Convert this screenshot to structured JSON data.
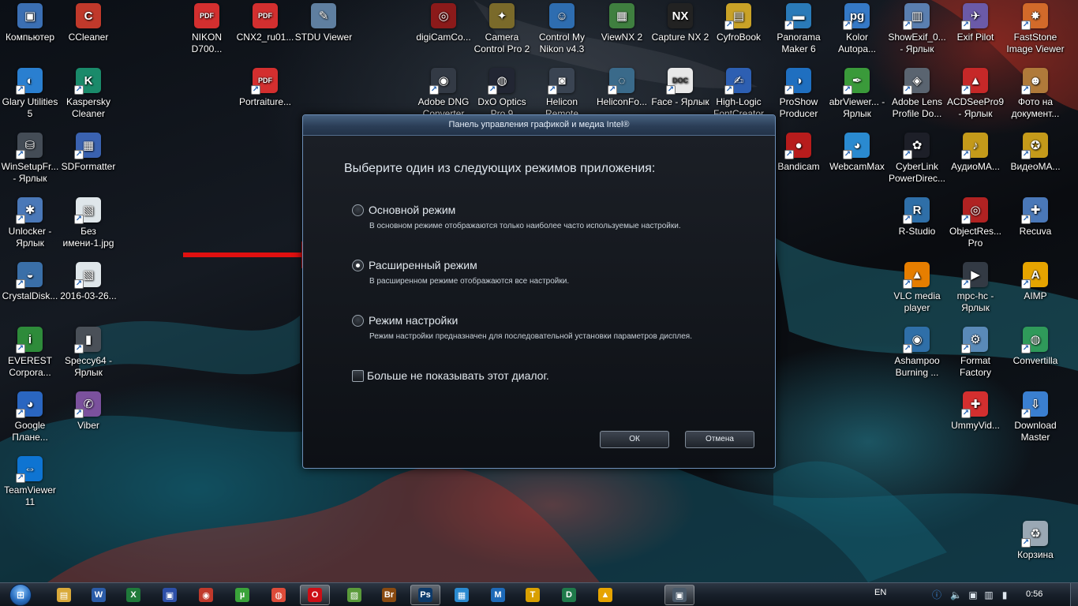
{
  "desktop": {
    "icons": [
      {
        "label": "Компьютер",
        "icon": "computer-icon",
        "color": "#3b6fb3",
        "glyph": "▣"
      },
      {
        "label": "CCleaner",
        "icon": "ccleaner-icon",
        "color": "#c0392b",
        "glyph": "C"
      },
      {
        "label": "NIKON D700...",
        "icon": "pdf-icon",
        "color": "#d32f2f",
        "glyph": "PDF"
      },
      {
        "label": "CNX2_ru01...",
        "icon": "pdf-icon",
        "color": "#d32f2f",
        "glyph": "PDF"
      },
      {
        "label": "STDU Viewer",
        "icon": "stdu-viewer-icon",
        "color": "#5f7fa0",
        "glyph": "✎"
      },
      {
        "label": "digiCamCo...",
        "icon": "digicam-icon",
        "color": "#8b1a1a",
        "glyph": "◎"
      },
      {
        "label": "Camera Control Pro 2",
        "icon": "camera-control-icon",
        "color": "#7a6a2a",
        "glyph": "✦"
      },
      {
        "label": "Control My Nikon v4.3",
        "icon": "control-nikon-icon",
        "color": "#2e6db0",
        "glyph": "☺"
      },
      {
        "label": "ViewNX 2",
        "icon": "viewnx-icon",
        "color": "#3f7f3f",
        "glyph": "▦"
      },
      {
        "label": "Capture NX 2",
        "icon": "capture-nx-icon",
        "color": "#222222",
        "glyph": "NX"
      },
      {
        "label": "CyfroBook",
        "icon": "cyfrobook-icon",
        "color": "#c9a227",
        "glyph": "▤"
      },
      {
        "label": "Panorama Maker 6",
        "icon": "panorama-icon",
        "color": "#2a7ab8",
        "glyph": "▬"
      },
      {
        "label": "Kolor Autopa...",
        "icon": "kolor-icon",
        "color": "#3579c6",
        "glyph": "pg"
      },
      {
        "label": "ShowExif_0... - Ярлык",
        "icon": "showexif-icon",
        "color": "#5a7fb0",
        "glyph": "▥"
      },
      {
        "label": "Exif Pilot",
        "icon": "exif-pilot-icon",
        "color": "#6b5aa8",
        "glyph": "✈"
      },
      {
        "label": "FastStone Image Viewer",
        "icon": "faststone-icon",
        "color": "#d26a2a",
        "glyph": "✸"
      },
      {
        "label": "Glary Utilities 5",
        "icon": "glary-icon",
        "color": "#2a7fd0",
        "glyph": "◐"
      },
      {
        "label": "Kaspersky Cleaner",
        "icon": "kaspersky-icon",
        "color": "#1a8a6a",
        "glyph": "K"
      },
      {
        "label": "Portraiture...",
        "icon": "pdf-icon",
        "color": "#d32f2f",
        "glyph": "PDF"
      },
      {
        "label": "Adobe DNG Converter",
        "icon": "adobe-dng-icon",
        "color": "#333a45",
        "glyph": "◉"
      },
      {
        "label": "DxO Optics Pro 9",
        "icon": "dxo-icon",
        "color": "#222633",
        "glyph": "◍"
      },
      {
        "label": "Helicon Remote",
        "icon": "helicon-remote-icon",
        "color": "#3a4452",
        "glyph": "◙"
      },
      {
        "label": "HeliconFo...",
        "icon": "helicon-focus-icon",
        "color": "#3a6a8a",
        "glyph": "◌"
      },
      {
        "label": "Face - Ярлык",
        "icon": "doc-icon",
        "color": "#e8e8e8",
        "glyph": "DOC"
      },
      {
        "label": "High-Logic FontCreator",
        "icon": "fontcreator-icon",
        "color": "#2d5fb2",
        "glyph": "✍"
      },
      {
        "label": "ProShow Producer",
        "icon": "proshow-icon",
        "color": "#1f6fc0",
        "glyph": "◑"
      },
      {
        "label": "abrViewer... - Ярлык",
        "icon": "abrviewer-icon",
        "color": "#3a9a3a",
        "glyph": "✒"
      },
      {
        "label": "Adobe Lens Profile Do...",
        "icon": "adobe-lens-icon",
        "color": "#5a6470",
        "glyph": "◈"
      },
      {
        "label": "ACDSeePro9 - Ярлык",
        "icon": "acdsee-icon",
        "color": "#c62828",
        "glyph": "▲"
      },
      {
        "label": "Фото на документ...",
        "icon": "photo-doc-icon",
        "color": "#b07a3a",
        "glyph": "☻"
      },
      {
        "label": "WinSetupFr... - Ярлык",
        "icon": "winsetup-icon",
        "color": "#444c56",
        "glyph": "⛁"
      },
      {
        "label": "SDFormatter",
        "icon": "sdformatter-icon",
        "color": "#3a62b0",
        "glyph": "▦"
      },
      {
        "label": "Bandicam",
        "icon": "bandicam-icon",
        "color": "#b71c1c",
        "glyph": "●"
      },
      {
        "label": "WebcamMax",
        "icon": "webcammax-icon",
        "color": "#2a8ad0",
        "glyph": "◕"
      },
      {
        "label": "CyberLink PowerDirec...",
        "icon": "powerdirector-icon",
        "color": "#1d1f28",
        "glyph": "✿"
      },
      {
        "label": "АудиоМА...",
        "icon": "audiomaster-icon",
        "color": "#c49a1a",
        "glyph": "♪"
      },
      {
        "label": "ВидеоМА...",
        "icon": "videomaster-icon",
        "color": "#c49a1a",
        "glyph": "✪"
      },
      {
        "label": "Unlocker - Ярлык",
        "icon": "unlocker-icon",
        "color": "#4a78b8",
        "glyph": "✱"
      },
      {
        "label": "Без имени-1.jpg",
        "icon": "image-file-icon",
        "color": "#dfe6ea",
        "glyph": "▧"
      },
      {
        "label": "R-Studio",
        "icon": "r-studio-icon",
        "color": "#2f6fa8",
        "glyph": "R"
      },
      {
        "label": "ObjectRes... Pro",
        "icon": "objectrescue-icon",
        "color": "#b02222",
        "glyph": "◎"
      },
      {
        "label": "Recuva",
        "icon": "recuva-icon",
        "color": "#4a78b8",
        "glyph": "✚"
      },
      {
        "label": "CrystalDisk...",
        "icon": "crystaldisk-icon",
        "color": "#3a6fa8",
        "glyph": "◒"
      },
      {
        "label": "2016-03-26...",
        "icon": "image-file-icon",
        "color": "#dfe6ea",
        "glyph": "▧"
      },
      {
        "label": "VLC media player",
        "icon": "vlc-icon",
        "color": "#e67e00",
        "glyph": "▲"
      },
      {
        "label": "mpc-hc - Ярлык",
        "icon": "mpc-hc-icon",
        "color": "#333a44",
        "glyph": "▶"
      },
      {
        "label": "AIMP",
        "icon": "aimp-icon",
        "color": "#e6a400",
        "glyph": "A"
      },
      {
        "label": "EVEREST Corpora...",
        "icon": "everest-icon",
        "color": "#2e8b3a",
        "glyph": "i"
      },
      {
        "label": "Speccy64 - Ярлык",
        "icon": "speccy-icon",
        "color": "#4a5058",
        "glyph": "▮"
      },
      {
        "label": "Ashampoo Burning ...",
        "icon": "ashampoo-icon",
        "color": "#2f6fa8",
        "glyph": "◉"
      },
      {
        "label": "Format Factory",
        "icon": "format-factory-icon",
        "color": "#5a8ab8",
        "glyph": "⚙"
      },
      {
        "label": "Convertilla",
        "icon": "convertilla-icon",
        "color": "#2f9a5a",
        "glyph": "◍"
      },
      {
        "label": "Google Плане...",
        "icon": "google-earth-icon",
        "color": "#2a66c0",
        "glyph": "◕"
      },
      {
        "label": "Viber",
        "icon": "viber-icon",
        "color": "#7b519d",
        "glyph": "✆"
      },
      {
        "label": "UmmyVid...",
        "icon": "ummy-icon",
        "color": "#d32f2f",
        "glyph": "✚"
      },
      {
        "label": "Download Master",
        "icon": "download-master-icon",
        "color": "#3a7fd0",
        "glyph": "⇩"
      },
      {
        "label": "TeamViewer 11",
        "icon": "teamviewer-icon",
        "color": "#0e74d2",
        "glyph": "⇔"
      },
      {
        "label": "Корзина",
        "icon": "recycle-bin-icon",
        "color": "#9aa8b4",
        "glyph": "♻"
      }
    ]
  },
  "dialog": {
    "title": "Панель управления графикой и медиа Intel®",
    "heading": "Выберите один из следующих режимов приложения:",
    "modes": [
      {
        "label": "Основной режим",
        "description": "В основном режиме отображаются только наиболее часто используемые настройки.",
        "checked": false
      },
      {
        "label": "Расширенный режим",
        "description": "В расширенном режиме отображаются все настройки.",
        "checked": true
      },
      {
        "label": "Режим настройки",
        "description": "Режим настройки предназначен для последовательной установки параметров дисплея.",
        "checked": false
      }
    ],
    "dont_show_label": "Больше не показывать этот диалог.",
    "ok_label": "ОК",
    "cancel_label": "Отмена"
  },
  "taskbar": {
    "apps": [
      {
        "icon": "explorer-icon",
        "color": "#d9a93a",
        "glyph": "▤",
        "active": false
      },
      {
        "icon": "word-icon",
        "color": "#2b5ca8",
        "glyph": "W",
        "active": false
      },
      {
        "icon": "excel-icon",
        "color": "#1f7a3a",
        "glyph": "X",
        "active": false
      },
      {
        "icon": "floppy-icon",
        "color": "#2d4fa8",
        "glyph": "▣",
        "active": false
      },
      {
        "icon": "app-red-icon",
        "color": "#c0392b",
        "glyph": "◉",
        "active": false
      },
      {
        "icon": "utorrent-icon",
        "color": "#3aa33a",
        "glyph": "µ",
        "active": false
      },
      {
        "icon": "chrome-icon",
        "color": "#dd4b39",
        "glyph": "◍",
        "active": false
      },
      {
        "icon": "opera-icon",
        "color": "#cc0f16",
        "glyph": "O",
        "active": true
      },
      {
        "icon": "faststone-taskbar-icon",
        "color": "#5a9a3a",
        "glyph": "▨",
        "active": false
      },
      {
        "icon": "bridge-icon",
        "color": "#8a4a10",
        "glyph": "Br",
        "active": false
      },
      {
        "icon": "photoshop-icon",
        "color": "#0d3a6a",
        "glyph": "Ps",
        "active": true
      },
      {
        "icon": "app-blue-icon",
        "color": "#2a8ad0",
        "glyph": "▦",
        "active": false
      },
      {
        "icon": "m-icon",
        "color": "#1e6ab8",
        "glyph": "M",
        "active": false
      },
      {
        "icon": "t-icon",
        "color": "#d9a000",
        "glyph": "T",
        "active": false
      },
      {
        "icon": "d-icon",
        "color": "#1f7a4a",
        "glyph": "D",
        "active": false
      },
      {
        "icon": "aimp-taskbar-icon",
        "color": "#e6a400",
        "glyph": "▲",
        "active": false
      },
      {
        "icon": "intel-panel-icon",
        "color": "#4a5a6a",
        "glyph": "▣",
        "active": true
      }
    ],
    "language": "EN",
    "clock": "0:56"
  },
  "colors": {
    "arrow": "#e01010",
    "dialog_border": "#6d8fb8"
  }
}
